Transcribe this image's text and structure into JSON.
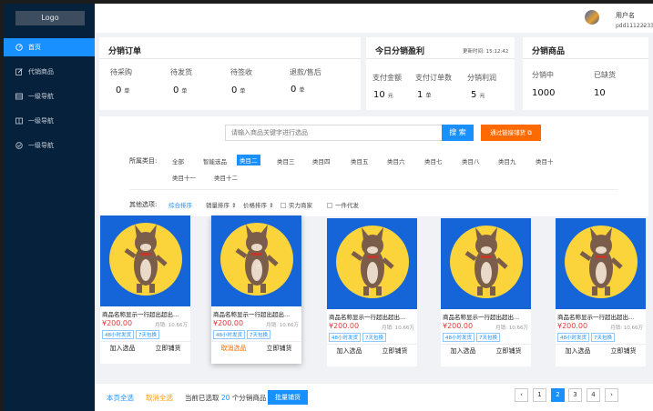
{
  "sidebar": {
    "logo": "Logo",
    "items": [
      {
        "label": "首页",
        "icon": "dashboard-icon"
      },
      {
        "label": "代销商品",
        "icon": "edit-icon"
      },
      {
        "label": "一级导航",
        "icon": "table-icon"
      },
      {
        "label": "一级导航",
        "icon": "book-icon"
      },
      {
        "label": "一级导航",
        "icon": "check-circle-icon"
      }
    ]
  },
  "header": {
    "user_label": "用户名",
    "account": "pdd111222333"
  },
  "orders": {
    "title": "分销订单",
    "stats": [
      {
        "label": "待采购",
        "value": "0",
        "unit": "单"
      },
      {
        "label": "待发货",
        "value": "0",
        "unit": "单"
      },
      {
        "label": "待签收",
        "value": "0",
        "unit": "单"
      },
      {
        "label": "退款/售后",
        "value": "0",
        "unit": "单"
      }
    ]
  },
  "profit": {
    "title": "今日分销盈利",
    "updated": "更新时间: 15:12:42",
    "stats": [
      {
        "label": "支付金额",
        "value": "10",
        "unit": "元"
      },
      {
        "label": "支付订单数",
        "value": "1",
        "unit": "单"
      },
      {
        "label": "分销利润",
        "value": "5",
        "unit": "元"
      }
    ]
  },
  "goods": {
    "title": "分销商品",
    "stats": [
      {
        "label": "分销中",
        "value": "1000"
      },
      {
        "label": "已缺货",
        "value": "10"
      }
    ]
  },
  "search": {
    "placeholder": "请输入商品关键字进行选品",
    "button": "搜 索",
    "link_button": "通过链接铺货"
  },
  "filters": {
    "category_label": "所属类目:",
    "categories": [
      "全部",
      "智能选品",
      "类目二",
      "类目三",
      "类目四",
      "类目五",
      "类目六",
      "类目七",
      "类目八",
      "类目九",
      "类目十",
      "类目十一",
      "类目十二"
    ],
    "active_category": "类目二",
    "other_label": "其他选项:",
    "sorts": [
      "综合排序",
      "销量排序 ⇕",
      "价格排序 ⇕"
    ],
    "checks": [
      "实力商家",
      "一件代发"
    ]
  },
  "products": [
    {
      "name": "商品名称显示一行超出超出...",
      "price": "¥200.00",
      "sold": "月销: 10.66万",
      "tags": [
        "48小时发货",
        "7天包换"
      ],
      "btn1": "加入选品",
      "btn2": "立即铺货"
    },
    {
      "name": "商品名称显示一行超出超出...",
      "price": "¥200.00",
      "sold": "月销: 10.66万",
      "tags": [
        "48小时发货",
        "7天包换"
      ],
      "btn1": "取消选品",
      "btn2": "立即铺货"
    },
    {
      "name": "商品名称显示一行超出超出...",
      "price": "¥200.00",
      "sold": "月销: 10.66万",
      "tags": [
        "48小时发货",
        "7天包换"
      ],
      "btn1": "加入选品",
      "btn2": "立即铺货"
    },
    {
      "name": "商品名称显示一行超出超出...",
      "price": "¥200.00",
      "sold": "月销: 10.66万",
      "tags": [
        "48小时发货",
        "7天包换"
      ],
      "btn1": "加入选品",
      "btn2": "立即铺货"
    },
    {
      "name": "商品名称显示一行超出超出...",
      "price": "¥200.00",
      "sold": "月销: 10.66万",
      "tags": [
        "48小时发货",
        "7天包换"
      ],
      "btn1": "加入选品",
      "btn2": "立即铺货"
    }
  ],
  "bottom": {
    "select_page": "本页全选",
    "cancel_all": "取消全选",
    "selected_prefix": "当前已选取",
    "selected_count": "20",
    "selected_suffix": "个分销商品",
    "batch": "批量铺货"
  },
  "pagination": {
    "prev": "‹",
    "pages": [
      "1",
      "2",
      "3",
      "4"
    ],
    "current": "2",
    "next": "›"
  },
  "colors": {
    "accent": "#1890ff",
    "orange": "#ff6a00",
    "price": "#e4393c",
    "sidebar": "#06213c"
  }
}
